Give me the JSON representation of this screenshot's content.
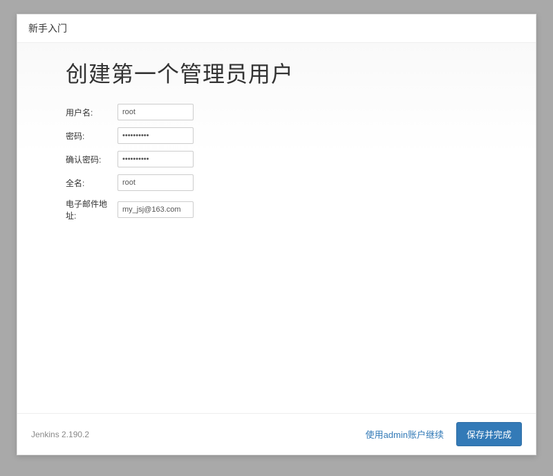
{
  "header": {
    "title": "新手入门"
  },
  "main": {
    "title": "创建第一个管理员用户",
    "fields": {
      "username": {
        "label": "用户名:",
        "value": "root"
      },
      "password": {
        "label": "密码:",
        "value": "••••••••••"
      },
      "confirm_password": {
        "label": "确认密码:",
        "value": "••••••••••"
      },
      "fullname": {
        "label": "全名:",
        "value": "root"
      },
      "email": {
        "label": "电子邮件地址:",
        "value": "my_jsj@163.com"
      }
    }
  },
  "footer": {
    "version": "Jenkins 2.190.2",
    "continue_as_admin": "使用admin账户继续",
    "save_and_finish": "保存并完成"
  }
}
